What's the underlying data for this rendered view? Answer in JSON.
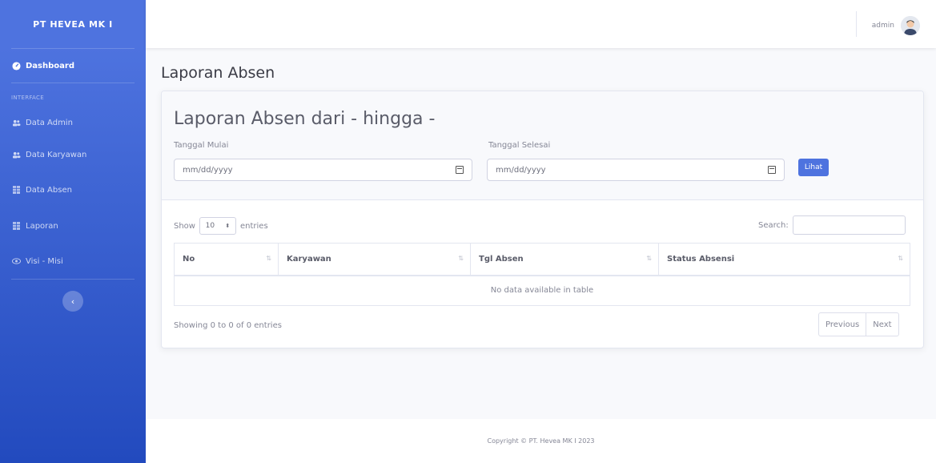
{
  "sidebar": {
    "brand": "PT HEVEA MK I",
    "dashboard": "Dashboard",
    "heading": "INTERFACE",
    "items": [
      {
        "label": "Data Admin",
        "icon": "users-icon"
      },
      {
        "label": "Data Karyawan",
        "icon": "users-icon"
      },
      {
        "label": "Data Absen",
        "icon": "table-icon"
      },
      {
        "label": "Laporan",
        "icon": "table-icon"
      },
      {
        "label": "Visi - Misi",
        "icon": "eye-icon"
      }
    ],
    "toggle_glyph": "‹"
  },
  "topbar": {
    "username": "admin"
  },
  "page": {
    "title": "Laporan Absen",
    "card_title": "Laporan Absen dari - hingga -",
    "start_label": "Tanggal Mulai",
    "end_label": "Tanggal Selesai",
    "date_placeholder": "mm/dd/yyyy",
    "view_button": "Lihat"
  },
  "table": {
    "show_label": "Show",
    "entries_value": "10",
    "entries_label": "entries",
    "search_label": "Search:",
    "columns": [
      "No",
      "Karyawan",
      "Tgl Absen",
      "Status Absensi"
    ],
    "empty_message": "No data available in table",
    "info": "Showing 0 to 0 of 0 entries",
    "prev": "Previous",
    "next": "Next"
  },
  "footer": {
    "copyright": "Copyright © PT. Hevea MK I 2023"
  },
  "colors": {
    "primary": "#4e73df",
    "sidebar_dark": "#224abe"
  }
}
